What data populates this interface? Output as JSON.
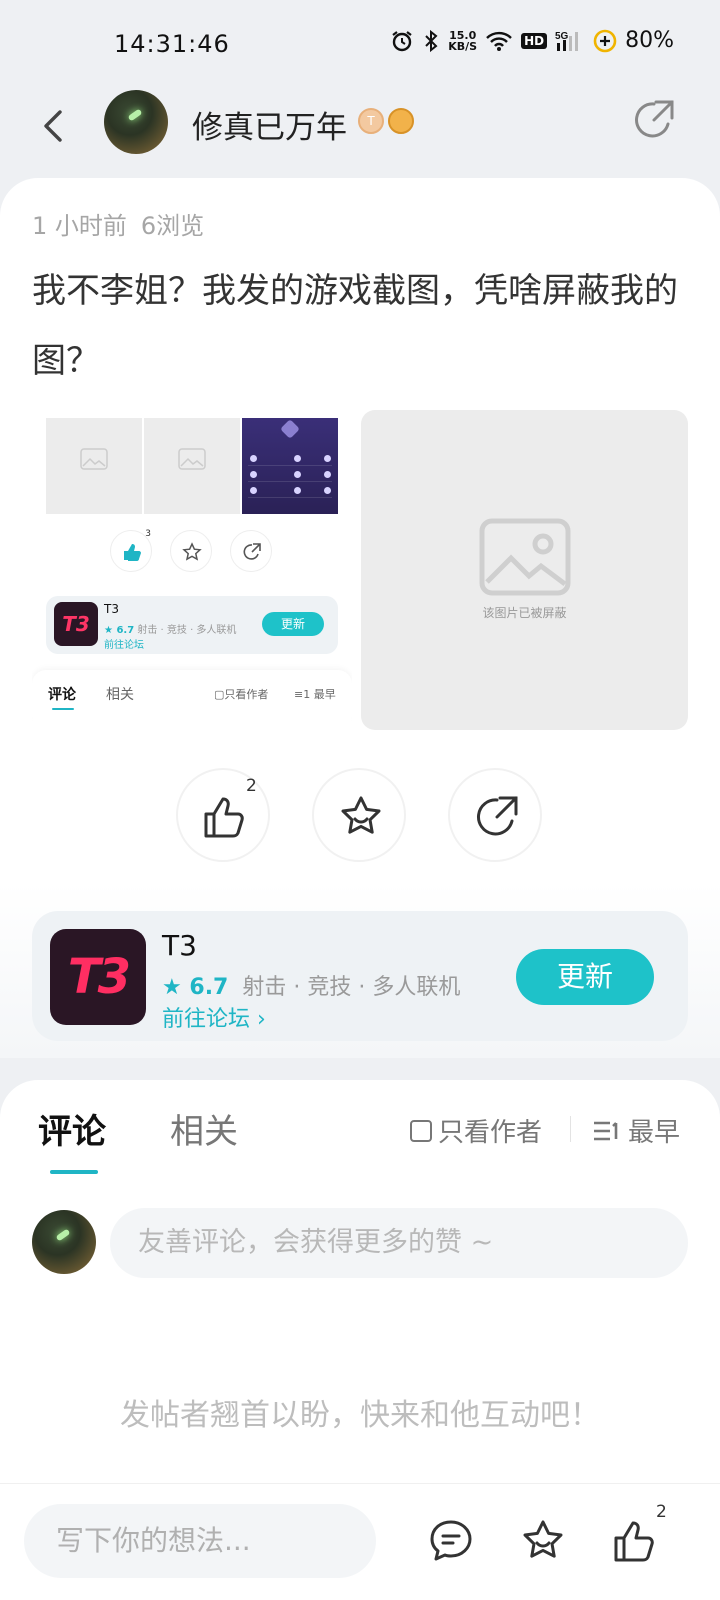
{
  "status_bar": {
    "time": "14:31:46",
    "net_speed_value": "15.0",
    "net_speed_unit": "KB/S",
    "hd": "HD",
    "network": "5G",
    "battery": "80%"
  },
  "header": {
    "author_name": "修真已万年"
  },
  "post": {
    "time_ago": "1 小时前",
    "views": "6浏览",
    "text": "我不李姐？我发的游戏截图，凭啥屏蔽我的图？",
    "blocked_image_label": "该图片已被屏蔽",
    "like_count": "2"
  },
  "screenshot_preview": {
    "like_count": "3",
    "game_name": "T3",
    "game_rating": "6.7",
    "game_tags": "射击 · 竞技 · 多人联机",
    "forum_link": "前往论坛",
    "update_label": "更新",
    "tab_comment": "评论",
    "tab_related": "相关",
    "only_author": "只看作者",
    "sort": "最早"
  },
  "game_card": {
    "logo_text": "T3",
    "name": "T3",
    "rating": "6.7",
    "tags": "射击 · 竞技 · 多人联机",
    "forum_link": "前往论坛 ›",
    "update_label": "更新"
  },
  "comments": {
    "tab_comment": "评论",
    "tab_related": "相关",
    "only_author": "只看作者",
    "sort": "最早",
    "input_placeholder": "友善评论，会获得更多的赞 ~",
    "empty_text": "发帖者翘首以盼，快来和他互动吧！"
  },
  "bottom_bar": {
    "input_placeholder": "写下你的想法...",
    "like_count": "2"
  },
  "colors": {
    "accent": "#1EC2C9",
    "link": "#1FB5C5",
    "game_logo_bg": "#2A1625",
    "game_logo_fg": "#FF2E62"
  }
}
